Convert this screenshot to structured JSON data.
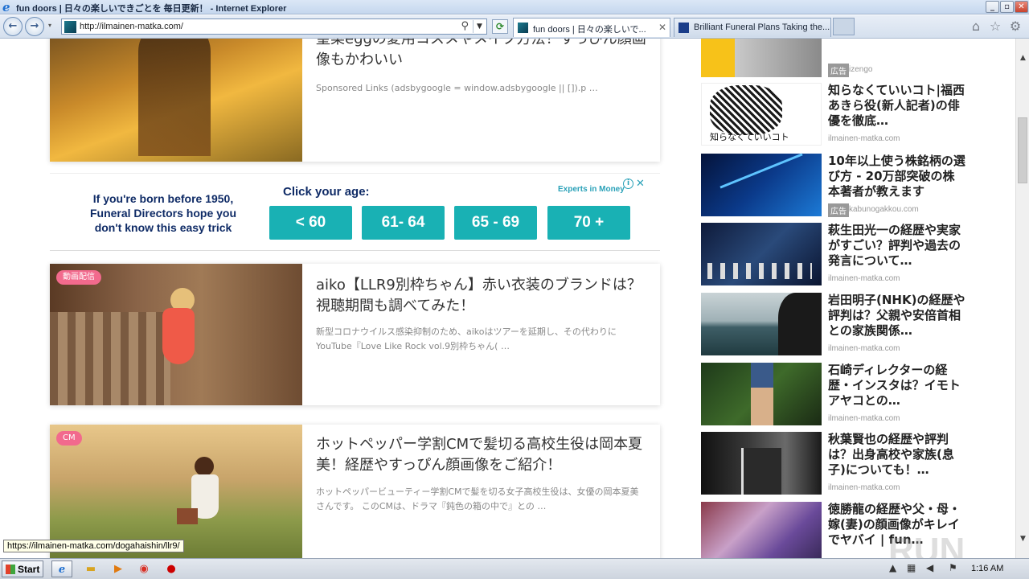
{
  "window": {
    "title": "fun doors | 日々の楽しいできごとを 毎日更新！ - Internet Explorer",
    "icon": "ie-icon"
  },
  "nav": {
    "url": "http://ilmainen-matka.com/",
    "tabs": [
      {
        "label": "fun doors | 日々の楽しいで...",
        "active": true
      },
      {
        "label": "Brilliant Funeral Plans Taking the...",
        "active": false
      }
    ]
  },
  "cards": [
    {
      "title": "聖菜eggの愛用コスメやメイク方法！すっぴん顔画像もかわいい",
      "excerpt": "Sponsored Links (adsbygoogle = window.adsbygoogle || []).p …",
      "tag": ""
    },
    {
      "title": "aiko【LLR9別枠ちゃん】赤い衣装のブランドは？視聴期間も調べてみた！",
      "excerpt": "新型コロナウイルス感染抑制のため、aikoはツアーを延期し、その代わりにYouTube『Love Like Rock vol.9別枠ちゃん( …",
      "tag": "動画配信"
    },
    {
      "title": "ホットペッパー学割CMで髪切る高校生役は岡本夏美！経歴やすっぴん顔画像をご紹介！",
      "excerpt": "ホットペッパービューティー学割CMで髪を切る女子高校生役は、女優の岡本夏美さんです。 このCMは、ドラマ『鈍色の箱の中で』との …",
      "tag": "CM"
    }
  ],
  "ad": {
    "left_text": "If you're born before 1950, Funeral Directors hope you don't know this easy trick",
    "cta": "Click your age:",
    "brand": "Experts in Money",
    "buttons": [
      "< 60",
      "61- 64",
      "65 - 69",
      "70 +"
    ]
  },
  "sidebar": [
    {
      "title": "",
      "source": "izengo",
      "ad": true,
      "ad_label": "広告"
    },
    {
      "title": "知らなくていいコト|福西あきら役(新人記者)の俳優を徹底…",
      "source": "ilmainen-matka.com",
      "ad": false,
      "img_caption": "知らなくていいコト"
    },
    {
      "title": "10年以上使う株銘柄の選び方 - 20万部突破の株本著者が教えます",
      "source": "kabunogakkou.com",
      "ad": true,
      "ad_label": "広告"
    },
    {
      "title": "萩生田光一の経歴や実家がすごい？評判や過去の発言について…",
      "source": "ilmainen-matka.com",
      "ad": false
    },
    {
      "title": "岩田明子(NHK)の経歴や評判は？父親や安倍首相との家族関係…",
      "source": "ilmainen-matka.com",
      "ad": false
    },
    {
      "title": "石崎ディレクターの経歴・インスタは？イモトアヤコとの…",
      "source": "ilmainen-matka.com",
      "ad": false
    },
    {
      "title": "秋葉賢也の経歴や評判は？出身高校や家族(息子)についても！…",
      "source": "ilmainen-matka.com",
      "ad": false
    },
    {
      "title": "徳勝龍の経歴や父・母・嫁(妻)の顔画像がキレイでヤバイ | fun…",
      "source": "",
      "ad": false
    }
  ],
  "status_url": "https://ilmainen-matka.com/dogahaishin/llr9/",
  "watermark": "RUN",
  "taskbar": {
    "start": "Start",
    "clock": "1:16 AM"
  }
}
